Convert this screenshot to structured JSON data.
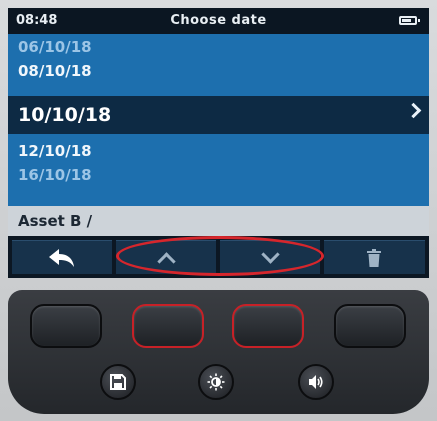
{
  "status_bar": {
    "time": "08:48",
    "title": "Choose date"
  },
  "date_list": {
    "items": [
      {
        "label": "06/10/18",
        "selected": false
      },
      {
        "label": "08/10/18",
        "selected": false
      },
      {
        "label": "10/10/18",
        "selected": true
      },
      {
        "label": "12/10/18",
        "selected": false
      },
      {
        "label": "16/10/18",
        "selected": false
      }
    ]
  },
  "breadcrumb": {
    "path": "Asset B /"
  },
  "softkeys": [
    {
      "icon": "back-arrow-icon"
    },
    {
      "icon": "chevron-up-icon"
    },
    {
      "icon": "chevron-down-icon"
    },
    {
      "icon": "trash-icon"
    }
  ],
  "hardware_keys": {
    "function_keys": [
      {
        "highlighted": false
      },
      {
        "highlighted": true
      },
      {
        "highlighted": true
      },
      {
        "highlighted": false
      }
    ],
    "round_keys": [
      {
        "icon": "save-icon"
      },
      {
        "icon": "brightness-icon"
      },
      {
        "icon": "volume-icon"
      }
    ]
  },
  "colors": {
    "list_background": "#1d6fae",
    "selected_row": "#0d2a44",
    "highlight": "#d6262c"
  }
}
